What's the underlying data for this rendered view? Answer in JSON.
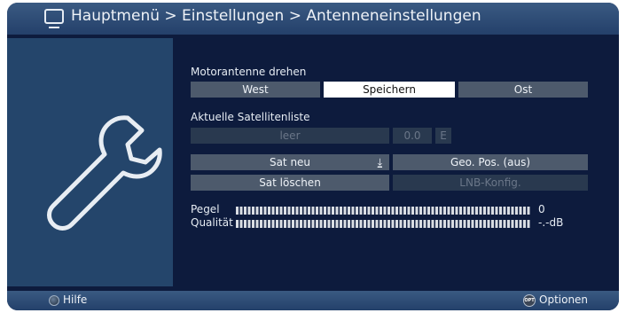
{
  "header": {
    "breadcrumb": "Hauptmenü > Einstellungen > Antenneneinstellungen"
  },
  "motor": {
    "label": "Motorantenne drehen",
    "buttons": [
      "West",
      "Speichern",
      "Ost"
    ],
    "selected": "Speichern"
  },
  "satlist": {
    "label": "Aktuelle Satellitenliste",
    "value": "leer",
    "position": "0.0",
    "direction": "E"
  },
  "actions": {
    "sat_new": "Sat neu",
    "geo_pos": "Geo. Pos. (aus)",
    "sat_delete": "Sat löschen",
    "lnb_config": "LNB-Konfig."
  },
  "meters": {
    "pegel_label": "Pegel",
    "pegel_value": "0",
    "qualitaet_label": "Qualität",
    "qualitaet_value": "-.-dB"
  },
  "footer": {
    "help_label": "Hilfe",
    "options_icon": "OPT",
    "options_label": "Optionen"
  },
  "colors": {
    "background": "#0d1b3d",
    "panel": "#24456b",
    "button": "#4d5a6c",
    "button_selected": "#ffffff",
    "button_disabled": "#29394f"
  }
}
